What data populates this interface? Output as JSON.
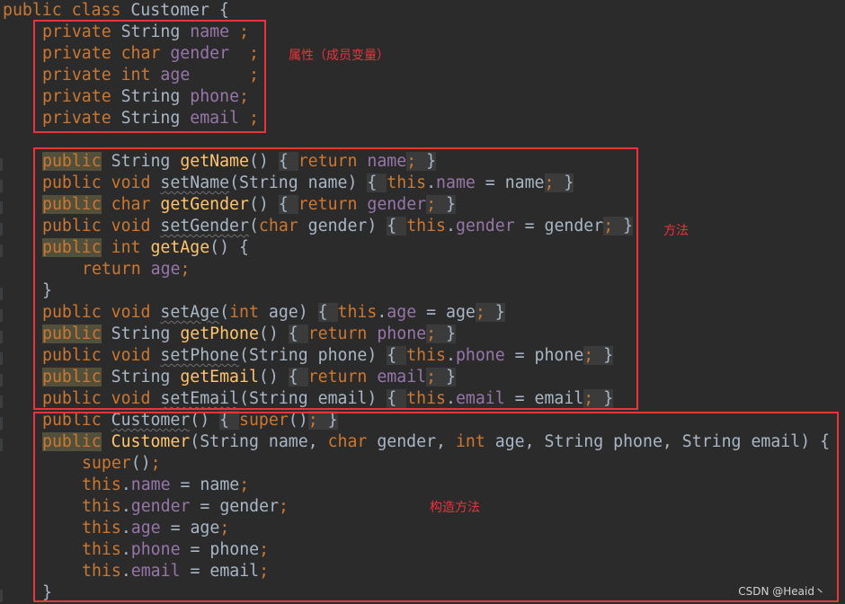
{
  "editor": {
    "code": {
      "l1": [
        "public class ",
        "Customer {"
      ],
      "l2": [
        "private ",
        "String ",
        "name",
        " ;"
      ],
      "l3": [
        "private ",
        "char ",
        "gender",
        "  ;"
      ],
      "l4": [
        "private ",
        "int ",
        "age",
        "      ;"
      ],
      "l5": [
        "private ",
        "String ",
        "phone",
        ";"
      ],
      "l6": [
        "private ",
        "String ",
        "email",
        " ;"
      ],
      "l8": [
        "public",
        " String ",
        "getName",
        "() ",
        "{ ",
        "return ",
        "name",
        "; ",
        "}"
      ],
      "l9": [
        "public void ",
        "setName",
        "(String name) ",
        "{ ",
        "this",
        ".",
        "name",
        " = name",
        "; ",
        "}"
      ],
      "l10": [
        "public",
        " char ",
        "getGender",
        "() ",
        "{ ",
        "return ",
        "gender",
        "; ",
        "}"
      ],
      "l11": [
        "public void ",
        "setGender",
        "(",
        "char ",
        "gender) ",
        "{ ",
        "this",
        ".",
        "gender",
        " = gender",
        "; ",
        "}"
      ],
      "l12": [
        "public",
        " int ",
        "getAge",
        "() {"
      ],
      "l13": [
        "return ",
        "age",
        ";"
      ],
      "l14": [
        "}"
      ],
      "l15": [
        "public void ",
        "setAge",
        "(",
        "int ",
        "age) ",
        "{ ",
        "this",
        ".",
        "age",
        " = age",
        "; ",
        "}"
      ],
      "l16": [
        "public",
        " String ",
        "getPhone",
        "() ",
        "{ ",
        "return ",
        "phone",
        "; ",
        "}"
      ],
      "l17": [
        "public void ",
        "setPhone",
        "(String phone) ",
        "{ ",
        "this",
        ".",
        "phone",
        " = phone",
        "; ",
        "}"
      ],
      "l18": [
        "public",
        " String ",
        "getEmail",
        "() ",
        "{ ",
        "return ",
        "email",
        "; ",
        "}"
      ],
      "l19": [
        "public void ",
        "setEmail",
        "(String email) ",
        "{ ",
        "this",
        ".",
        "email",
        " = email",
        "; ",
        "}"
      ],
      "l20": [
        "public ",
        "Customer",
        "() ",
        "{ ",
        "super",
        "()",
        "; ",
        "}"
      ],
      "l21": [
        "public",
        " Customer",
        "(String name, ",
        "char ",
        "gender, ",
        "int ",
        "age, String phone, String email) {"
      ],
      "l22": [
        "super",
        "()",
        ";"
      ],
      "l23": [
        "this",
        ".",
        "name",
        " = name",
        ";"
      ],
      "l24": [
        "this",
        ".",
        "gender",
        " = gender",
        ";"
      ],
      "l25": [
        "this",
        ".",
        "age",
        " = age",
        ";"
      ],
      "l26": [
        "this",
        ".",
        "phone",
        " = phone",
        ";"
      ],
      "l27": [
        "this",
        ".",
        "email",
        " = email",
        ";"
      ],
      "l28": [
        "}"
      ]
    }
  },
  "annotations": {
    "fields": "属性（成员变量）",
    "methods": "方法",
    "constructors": "构造方法"
  },
  "watermark": "CSDN @Heaid丶",
  "colors": {
    "background": "#2b2b2b",
    "keyword": "#cc7832",
    "field": "#9876aa",
    "method": "#ffc66d",
    "text": "#a9b7c6",
    "annotation_red": "#e8353b"
  }
}
